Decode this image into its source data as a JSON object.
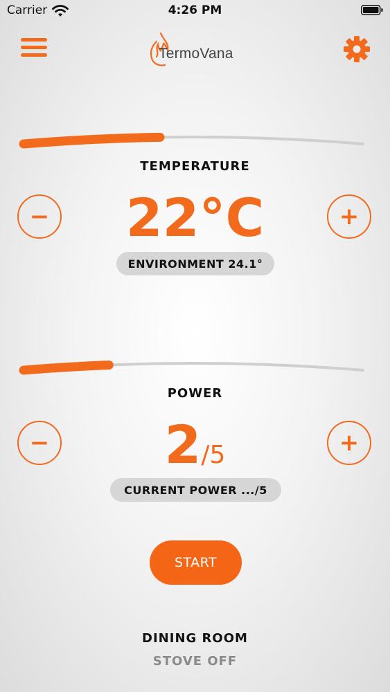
{
  "status_bar": {
    "carrier": "Carrier",
    "time": "4:26 PM",
    "icons": [
      "wifi-icon",
      "battery-icon"
    ]
  },
  "header": {
    "brand": "TermoVana",
    "menu_icon": "hamburger-menu-icon",
    "settings_icon": "gear-icon",
    "logo_icon": "flame-icon"
  },
  "temperature": {
    "label": "TEMPERATURE",
    "value": "22°C",
    "level_fraction": 0.4,
    "environment": "ENVIRONMENT 24.1°",
    "decrease_symbol": "−",
    "increase_symbol": "+"
  },
  "power": {
    "label": "POWER",
    "value": "2",
    "max": "/5",
    "level_fraction": 0.25,
    "current": "CURRENT POWER .../5",
    "decrease_symbol": "−",
    "increase_symbol": "+"
  },
  "actions": {
    "start_label": "START"
  },
  "footer": {
    "room": "DINING ROOM",
    "stove_status": "STOVE OFF"
  },
  "colors": {
    "accent": "#f26a1b",
    "track": "#cfcfcf",
    "pill": "#d6d6d6",
    "muted": "#8a8a8a"
  }
}
